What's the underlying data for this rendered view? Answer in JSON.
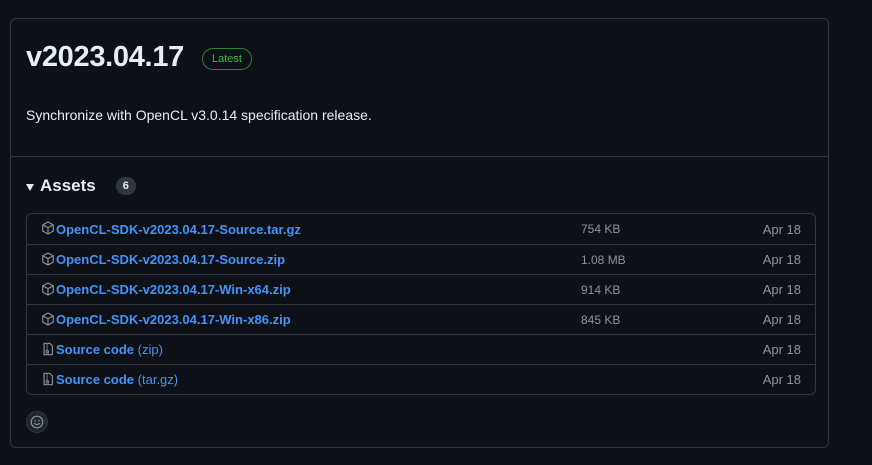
{
  "release": {
    "version": "v2023.04.17",
    "badge": "Latest",
    "description": "Synchronize with OpenCL v3.0.14 specification release."
  },
  "assets": {
    "title": "Assets",
    "count": "6",
    "items": [
      {
        "name": "OpenCL-SDK-v2023.04.17-Source.tar.gz",
        "size": "754 KB",
        "date": "Apr 18",
        "icon": "package-icon"
      },
      {
        "name": "OpenCL-SDK-v2023.04.17-Source.zip",
        "size": "1.08 MB",
        "date": "Apr 18",
        "icon": "package-icon"
      },
      {
        "name": "OpenCL-SDK-v2023.04.17-Win-x64.zip",
        "size": "914 KB",
        "date": "Apr 18",
        "icon": "package-icon"
      },
      {
        "name": "OpenCL-SDK-v2023.04.17-Win-x86.zip",
        "size": "845 KB",
        "date": "Apr 18",
        "icon": "package-icon"
      },
      {
        "name": "Source code",
        "suffix": "(zip)",
        "size": "",
        "date": "Apr 18",
        "icon": "file-zip-icon"
      },
      {
        "name": "Source code",
        "suffix": "(tar.gz)",
        "size": "",
        "date": "Apr 18",
        "icon": "file-zip-icon"
      }
    ]
  },
  "colors": {
    "background": "#0d1117",
    "border": "#30363d",
    "link": "#4493f8",
    "muted": "#8b949e",
    "latest_green": "#3fb950"
  },
  "reaction": {
    "icon": "smiley-icon"
  }
}
